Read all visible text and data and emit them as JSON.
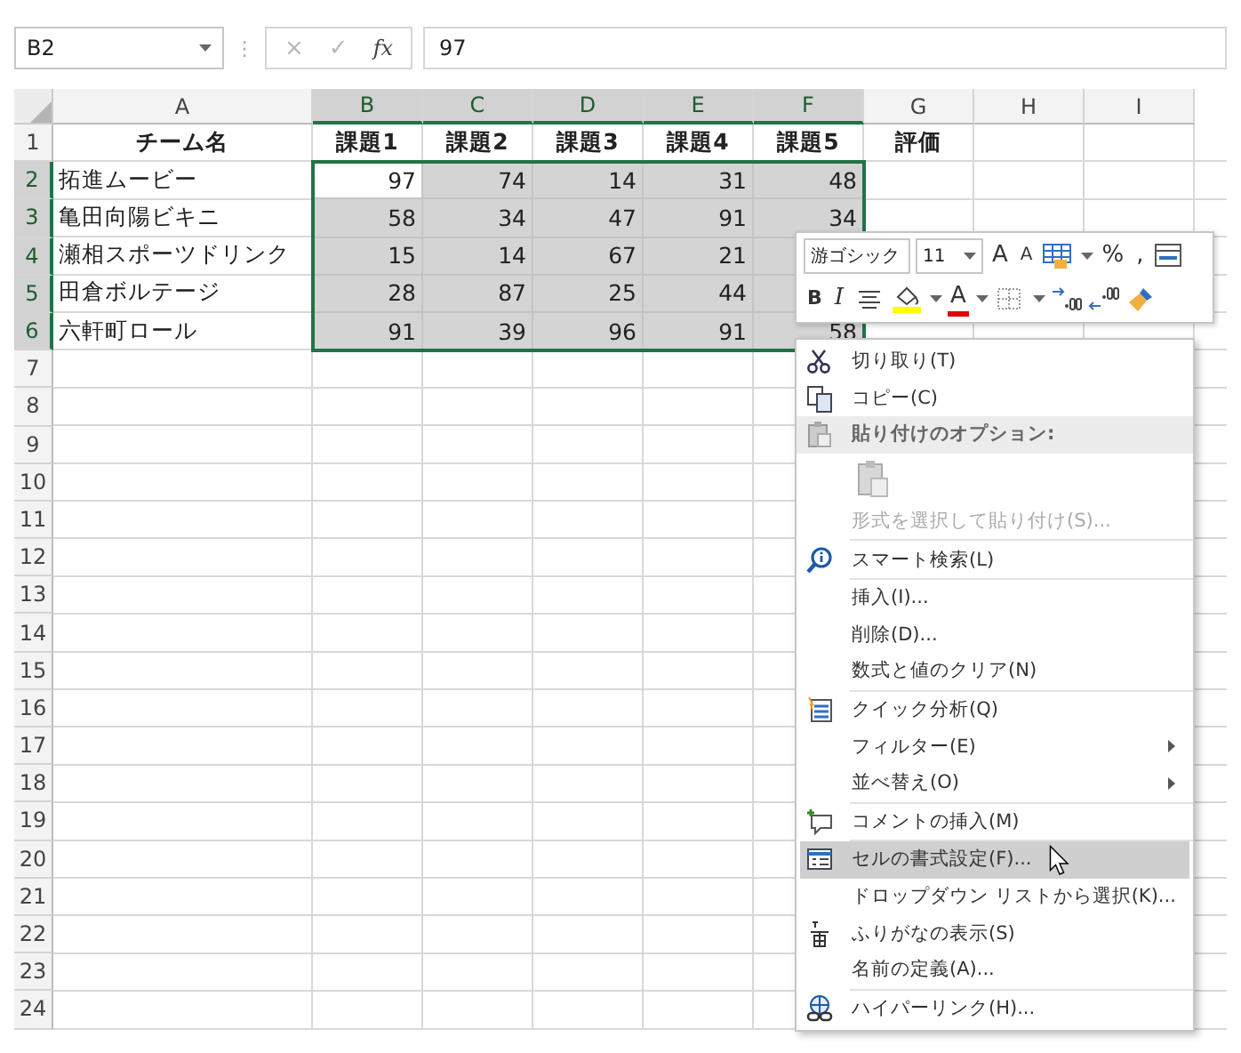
{
  "formula_bar": {
    "name_box": "B2",
    "splitter": "⋮",
    "cancel": "×",
    "enter": "✓",
    "function": "fx",
    "value": "97"
  },
  "columns": [
    {
      "label": "A",
      "selected": false
    },
    {
      "label": "B",
      "selected": true
    },
    {
      "label": "C",
      "selected": true
    },
    {
      "label": "D",
      "selected": true
    },
    {
      "label": "E",
      "selected": true
    },
    {
      "label": "F",
      "selected": true
    },
    {
      "label": "G",
      "selected": false
    },
    {
      "label": "H",
      "selected": false
    },
    {
      "label": "I",
      "selected": false
    }
  ],
  "rows": [
    {
      "number": "1",
      "selected": false,
      "kind": "header",
      "cells": [
        {
          "text": "チーム名",
          "selected": false
        },
        {
          "text": "課題1",
          "selected": false
        },
        {
          "text": "課題2",
          "selected": false
        },
        {
          "text": "課題3",
          "selected": false
        },
        {
          "text": "課題4",
          "selected": false
        },
        {
          "text": "課題5",
          "selected": false
        },
        {
          "text": "評価",
          "selected": false
        }
      ]
    },
    {
      "number": "2",
      "selected": true,
      "kind": "data",
      "cells": [
        {
          "text": "拓進ムービー",
          "selected": false
        },
        {
          "text": "97",
          "selected": true,
          "active": true
        },
        {
          "text": "74",
          "selected": true
        },
        {
          "text": "14",
          "selected": true
        },
        {
          "text": "31",
          "selected": true
        },
        {
          "text": "48",
          "selected": true
        }
      ]
    },
    {
      "number": "3",
      "selected": true,
      "kind": "data",
      "cells": [
        {
          "text": "亀田向陽ビキニ",
          "selected": false
        },
        {
          "text": "58",
          "selected": true
        },
        {
          "text": "34",
          "selected": true
        },
        {
          "text": "47",
          "selected": true
        },
        {
          "text": "91",
          "selected": true
        },
        {
          "text": "34",
          "selected": true
        }
      ]
    },
    {
      "number": "4",
      "selected": true,
      "kind": "data",
      "cells": [
        {
          "text": "瀬相スポーツドリンク",
          "selected": false
        },
        {
          "text": "15",
          "selected": true
        },
        {
          "text": "14",
          "selected": true
        },
        {
          "text": "67",
          "selected": true
        },
        {
          "text": "21",
          "selected": true
        },
        {
          "selected": true
        }
      ]
    },
    {
      "number": "5",
      "selected": true,
      "kind": "data",
      "cells": [
        {
          "text": "田倉ボルテージ",
          "selected": false
        },
        {
          "text": "28",
          "selected": true
        },
        {
          "text": "87",
          "selected": true
        },
        {
          "text": "25",
          "selected": true
        },
        {
          "text": "44",
          "selected": true
        },
        {
          "selected": true
        }
      ]
    },
    {
      "number": "6",
      "selected": true,
      "kind": "data",
      "cells": [
        {
          "text": "六軒町ロール",
          "selected": false
        },
        {
          "text": "91",
          "selected": true
        },
        {
          "text": "39",
          "selected": true
        },
        {
          "text": "96",
          "selected": true
        },
        {
          "text": "91",
          "selected": true
        },
        {
          "text": "58",
          "selected": true
        }
      ]
    },
    {
      "number": "7",
      "selected": false
    },
    {
      "number": "8",
      "selected": false
    },
    {
      "number": "9",
      "selected": false
    },
    {
      "number": "10",
      "selected": false
    },
    {
      "number": "11",
      "selected": false
    },
    {
      "number": "12",
      "selected": false
    },
    {
      "number": "13",
      "selected": false
    },
    {
      "number": "14",
      "selected": false
    },
    {
      "number": "15",
      "selected": false
    },
    {
      "number": "16",
      "selected": false
    },
    {
      "number": "17",
      "selected": false
    },
    {
      "number": "18",
      "selected": false
    },
    {
      "number": "19",
      "selected": false
    },
    {
      "number": "20",
      "selected": false
    },
    {
      "number": "21",
      "selected": false
    },
    {
      "number": "22",
      "selected": false
    },
    {
      "number": "23",
      "selected": false
    },
    {
      "number": "24",
      "selected": false
    }
  ],
  "mini_toolbar": {
    "font": "游ゴシック",
    "size": "11",
    "rows": [
      [
        {
          "kind": "glyph",
          "text": "A"
        },
        {
          "kind": "glyph",
          "text": "A"
        },
        {
          "kind": "icon",
          "caret": true
        },
        {
          "kind": "glyph",
          "text": "%"
        },
        {
          "kind": "glyph",
          "text": ","
        },
        {
          "kind": "icon"
        }
      ],
      [
        {
          "kind": "glyph",
          "text": "B"
        },
        {
          "kind": "glyph",
          "text": "I"
        },
        {
          "kind": "icon"
        },
        {
          "kind": "icon",
          "color": "#ffff00",
          "caret": true
        },
        {
          "kind": "glyph",
          "text": "A",
          "color": "#e00000",
          "caret": true
        },
        {
          "kind": "icon",
          "caret": true
        },
        {
          "kind": "icon"
        },
        {
          "kind": "icon"
        },
        {
          "kind": "icon"
        }
      ]
    ]
  },
  "context_menu": [
    {
      "kind": "item",
      "label": "切り取り(T)",
      "disabled": false,
      "selected": false
    },
    {
      "kind": "item",
      "label": "コピー(C)",
      "disabled": false,
      "selected": false
    },
    {
      "kind": "header",
      "label": "貼り付けのオプション:"
    },
    {
      "kind": "paste-options"
    },
    {
      "kind": "item",
      "label": "形式を選択して貼り付け(S)...",
      "disabled": true,
      "selected": false
    },
    {
      "kind": "separator"
    },
    {
      "kind": "item",
      "label": "スマート検索(L)",
      "disabled": false,
      "selected": false
    },
    {
      "kind": "separator"
    },
    {
      "kind": "item",
      "label": "挿入(I)...",
      "disabled": false,
      "selected": false
    },
    {
      "kind": "item",
      "label": "削除(D)...",
      "disabled": false,
      "selected": false
    },
    {
      "kind": "item",
      "label": "数式と値のクリア(N)",
      "disabled": false,
      "selected": false
    },
    {
      "kind": "separator"
    },
    {
      "kind": "item",
      "label": "クイック分析(Q)",
      "disabled": false,
      "selected": false
    },
    {
      "kind": "item",
      "label": "フィルター(E)",
      "submenu": true,
      "disabled": false,
      "selected": false
    },
    {
      "kind": "item",
      "label": "並べ替え(O)",
      "submenu": true,
      "disabled": false,
      "selected": false
    },
    {
      "kind": "separator"
    },
    {
      "kind": "item",
      "label": "コメントの挿入(M)",
      "disabled": false,
      "selected": false
    },
    {
      "kind": "separator"
    },
    {
      "kind": "item",
      "label": "セルの書式設定(F)...",
      "disabled": false,
      "selected": true
    },
    {
      "kind": "item",
      "label": "ドロップダウン リストから選択(K)...",
      "disabled": false,
      "selected": false
    },
    {
      "kind": "item",
      "label": "ふりがなの表示(S)",
      "disabled": false,
      "selected": false
    },
    {
      "kind": "item",
      "label": "名前の定義(A)...",
      "disabled": false,
      "selected": false
    },
    {
      "kind": "separator"
    },
    {
      "kind": "item",
      "label": "ハイパーリンク(H)...",
      "disabled": false,
      "selected": false
    }
  ]
}
